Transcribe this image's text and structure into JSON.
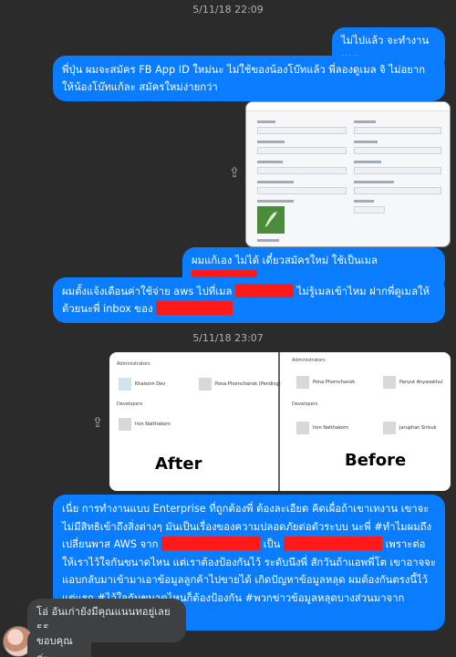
{
  "timestamps": [
    "5/11/18 22:09",
    "5/11/18 23:07"
  ],
  "messages": {
    "m1": "ไม่ไปแล้ว จะทำงานนนน",
    "m2": "พี่ปุ่น ผมจะสมัคร FB App ID ใหม่นะ ไม่ใช้ของน้องโบ๊ทแล้ว พี่ลองดูเมล จิ ไม่อยากให้น้องโบ๊ทแก้ละ สมัครใหม่ง่ายกว่า",
    "m3": "ผมแก้เอง ไม่ได้ เดี๋ยวสมัครใหม่ ใช้เป็นเมล",
    "m4a": "ผมตั้งแจ้งเตือนค่าใช้จ่าย aws ไปที่เมล",
    "m4b": "ไม่รู้เมลเข้าไหม ฝากพี่ดูเมลให้ด้วยนะพี่ inbox ของ",
    "m5a": "เนี่ย การทำงานแบบ Enterprise ที่ถูกต้องพี่ ต้องละเอียด คิดเผื่อถ้าเขาเทงาน เขาจะไม่มีสิทธิเข้าถึงสิ่งต่างๆ มันเป็นเรื่องของความปลอดภัยต่อตัวระบบ นะพี่ #ทำไมผมถึงเปลี่ยนพาส AWS จาก",
    "m5b": "เป็น",
    "m5c": "เพราะต่อให้เราไว้ใจกันขนาดไหน แต่เราต้องป้องกันไว้ ระดับนึงพี่ สักวันถ้าแอพพี่โต เขาอาจจะแอบกลับมาเข้ามาเอาข้อมูลลูกค้าไปขายได้ เกิดปัญหาข้อมูลหลุด ผมต้องกันตรงนี้ไว้ แต่แรก #ไว้ใจกันขนาดไหนก็ต้องป้องกัน #พวกข่าวข้อมูลหลุดบางส่วนมาจากพนักงานเก่า",
    "m6": "โอ่ อันเก่ายังมีคุณแนนทอยู่เลย 55",
    "m7": "ขอบคุณค่ะ"
  },
  "screenshot1": {
    "labels": [
      "App ID",
      "App Secret",
      "Display Name",
      "Namespace",
      "App Domains",
      "Contact Email",
      "Privacy Policy URL",
      "Terms of Service URL",
      "App Icon (1024 x 1024)",
      "Category",
      "Business Use"
    ],
    "values": {
      "app_secret_btn": "Show",
      "category": "Lifestyle"
    }
  },
  "screenshot2": {
    "administrators_label": "Administrators",
    "developers_label": "Developers",
    "after_admins": [
      "Khaisorn Dev",
      "Pona Phornchanok (Pending)"
    ],
    "after_devs": [
      "Iron Natthakorn"
    ],
    "before_admins": [
      "Pona Phornchanok",
      "Panyut Anyasakhul"
    ],
    "before_devs": [
      "Iron Natthakorn",
      "Jaruphan Sirisuk"
    ],
    "after_caption": "After",
    "before_caption": "Before"
  },
  "colors": {
    "outgoing": "#0a7cff",
    "incoming": "#3e4042",
    "redact": "#ff1a1a",
    "background": "#2b2b2b"
  }
}
